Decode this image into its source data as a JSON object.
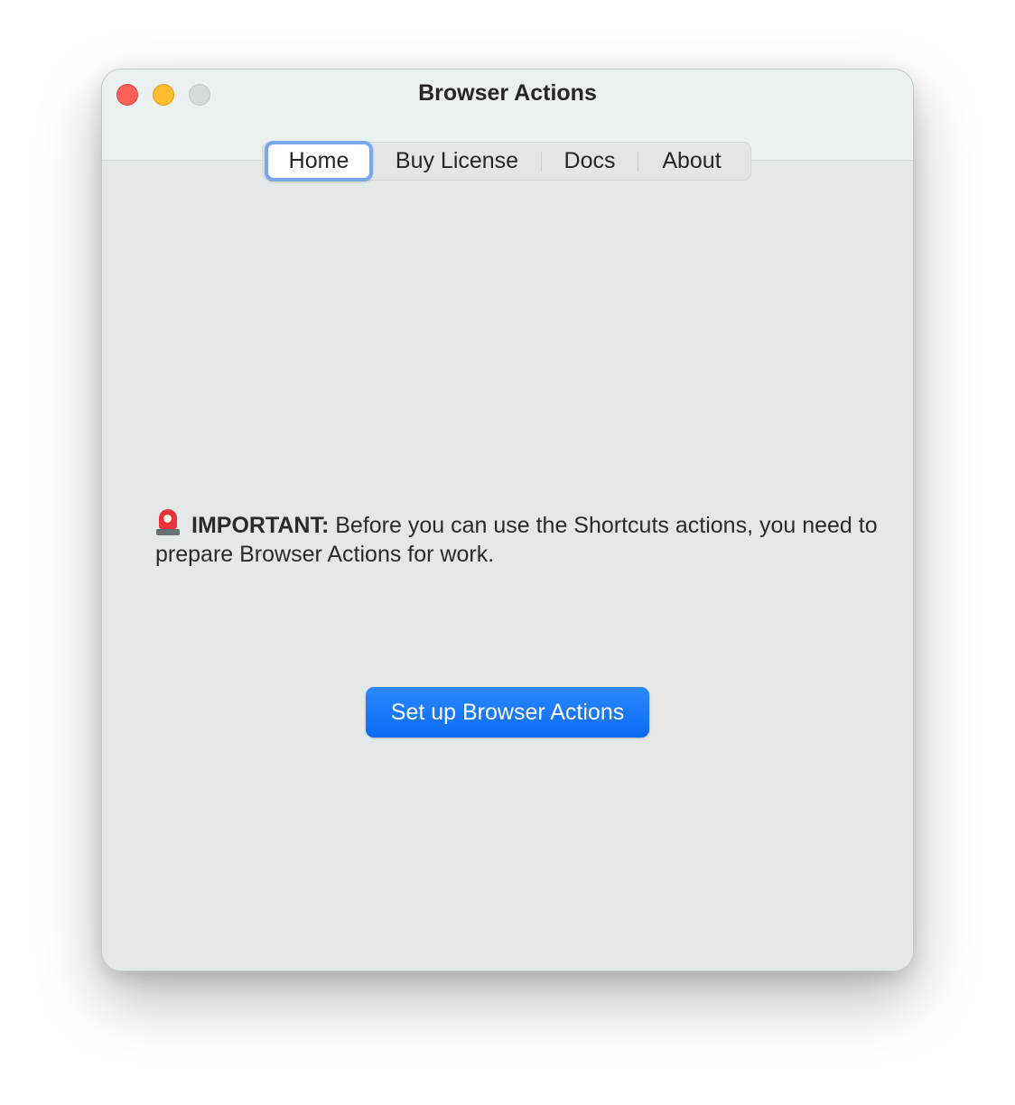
{
  "window": {
    "title": "Browser Actions"
  },
  "tabs": {
    "items": [
      {
        "label": "Home",
        "selected": true
      },
      {
        "label": "Buy License",
        "selected": false
      },
      {
        "label": "Docs",
        "selected": false
      },
      {
        "label": "About",
        "selected": false
      }
    ]
  },
  "home": {
    "icon": "police-siren-icon",
    "important_label": "IMPORTANT:",
    "important_text": " Before you can use the Shortcuts actions, you need to prepare Browser Actions for work.",
    "setup_button_label": "Set up Browser Actions"
  },
  "colors": {
    "accent": "#0a6af5",
    "selected_tab_ring": "#76a7ef",
    "close": "#fe5f57",
    "minimize": "#febc2e",
    "zoom_inactive": "#d7dadb"
  }
}
